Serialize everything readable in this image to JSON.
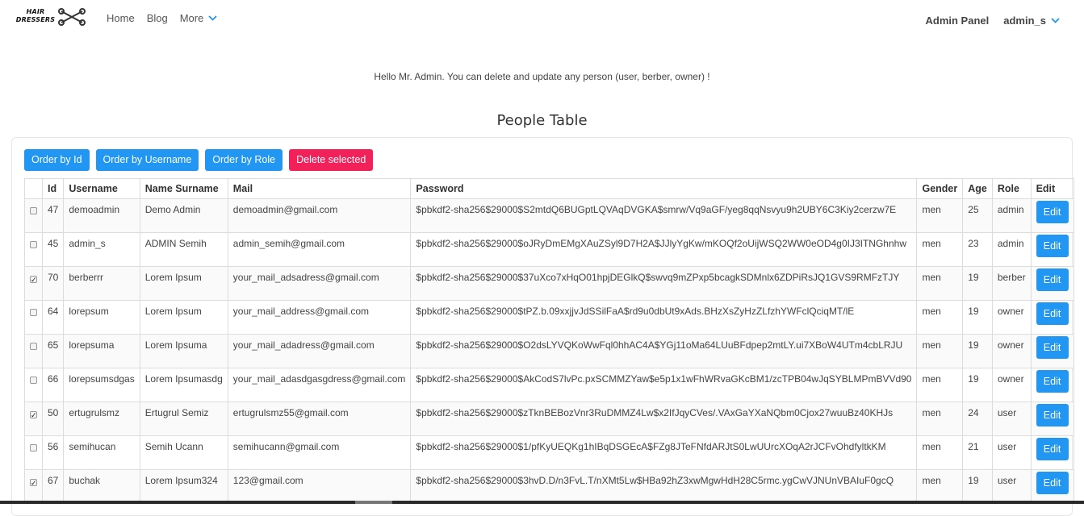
{
  "brand": {
    "line1": "HAIR",
    "line2": "DRESSERS"
  },
  "nav": {
    "home": "Home",
    "blog": "Blog",
    "more": "More",
    "admin_panel": "Admin Panel",
    "user": "admin_s"
  },
  "welcome": "Hello Mr. Admin. You can delete and update any person (user, berber, owner) !",
  "title": "People Table",
  "buttons": {
    "order_id": "Order by Id",
    "order_username": "Order by Username",
    "order_role": "Order by Role",
    "delete_selected": "Delete selected"
  },
  "colors": {
    "primary": "#2196f3",
    "danger": "#f2215a"
  },
  "table": {
    "headers": [
      "",
      "Id",
      "Username",
      "Name Surname",
      "Mail",
      "Password",
      "Gender",
      "Age",
      "Role",
      "Edit"
    ],
    "edit_label": "Edit",
    "rows": [
      {
        "checked": false,
        "id": "47",
        "username": "demoadmin",
        "name": "Demo Admin",
        "mail": "demoadmin@gmail.com",
        "password": "$pbkdf2-sha256$29000$S2mtdQ6BUGptLQVAqDVGKA$smrw/Vq9aGF/yeg8qqNsvyu9h2UBY6C3Kiy2cerzw7E",
        "gender": "men",
        "age": "25",
        "role": "admin"
      },
      {
        "checked": false,
        "id": "45",
        "username": "admin_s",
        "name": "ADMIN Semih",
        "mail": "admin_semih@gmail.com",
        "password": "$pbkdf2-sha256$29000$oJRyDmEMgXAuZSyl9D7H2A$JJlyYgKw/mKOQf2oUijWSQ2WW0eOD4g0IJ3ITNGhnhw",
        "gender": "men",
        "age": "23",
        "role": "admin"
      },
      {
        "checked": true,
        "id": "70",
        "username": "berberrr",
        "name": "Lorem Ipsum",
        "mail": "your_mail_adsadress@gmail.com",
        "password": "$pbkdf2-sha256$29000$37uXco7xHqO01hpjDEGlkQ$swvq9mZPxp5bcagkSDMnlx6ZDPiRsJQ1GVS9RMFzTJY",
        "gender": "men",
        "age": "19",
        "role": "berber"
      },
      {
        "checked": false,
        "id": "64",
        "username": "lorepsum",
        "name": "Lorem Ipsum",
        "mail": "your_mail_address@gmail.com",
        "password": "$pbkdf2-sha256$29000$tPZ.b.09xxjjvJdSSilFaA$rd9u0dbUt9xAds.BHzXsZyHzZLfzhYWFclQciqMT/lE",
        "gender": "men",
        "age": "19",
        "role": "owner"
      },
      {
        "checked": false,
        "id": "65",
        "username": "lorepsuma",
        "name": "Lorem Ipsuma",
        "mail": "your_mail_adadress@gmail.com",
        "password": "$pbkdf2-sha256$29000$O2dsLYVQKoWwFql0hhAC4A$YGj11oMa64LUuBFdpep2mtLY.ui7XBoW4UTm4cbLRJU",
        "gender": "men",
        "age": "19",
        "role": "owner"
      },
      {
        "checked": false,
        "id": "66",
        "username": "lorepsumsdgas",
        "name": "Lorem Ipsumasdg",
        "mail": "your_mail_adasdgasgdress@gmail.com",
        "password": "$pbkdf2-sha256$29000$AkCodS7lvPc.pxSCMMZYaw$e5p1x1wFhWRvaGKcBM1/zcTPB04wJqSYBLMPmBVVd90",
        "gender": "men",
        "age": "19",
        "role": "owner"
      },
      {
        "checked": true,
        "id": "50",
        "username": "ertugrulsmz",
        "name": "Ertugrul Semiz",
        "mail": "ertugrulsmz55@gmail.com",
        "password": "$pbkdf2-sha256$29000$zTknBEBozVnr3RuDMMZ4Lw$x2IfJqyCVes/.VAxGaYXaNQbm0Cjox27wuuBz40KHJs",
        "gender": "men",
        "age": "24",
        "role": "user"
      },
      {
        "checked": false,
        "id": "56",
        "username": "semihucan",
        "name": "Semih Ucann",
        "mail": "semihucann@gmail.com",
        "password": "$pbkdf2-sha256$29000$1/pfKyUEQKg1hIBqDSGEcA$FZg8JTeFNfdARJtS0LwUUrcXOqA2rJCFvOhdfyltkKM",
        "gender": "men",
        "age": "21",
        "role": "user"
      },
      {
        "checked": true,
        "id": "67",
        "username": "buchak",
        "name": "Lorem Ipsum324",
        "mail": "123@gmail.com",
        "password": "$pbkdf2-sha256$29000$3hvD.D/n3FvL.T/nXMt5Lw$HBa92hZ3xwMgwHdH28C5rmc.ygCwVJNUnVBAIuF0gcQ",
        "gender": "men",
        "age": "19",
        "role": "user"
      }
    ]
  }
}
